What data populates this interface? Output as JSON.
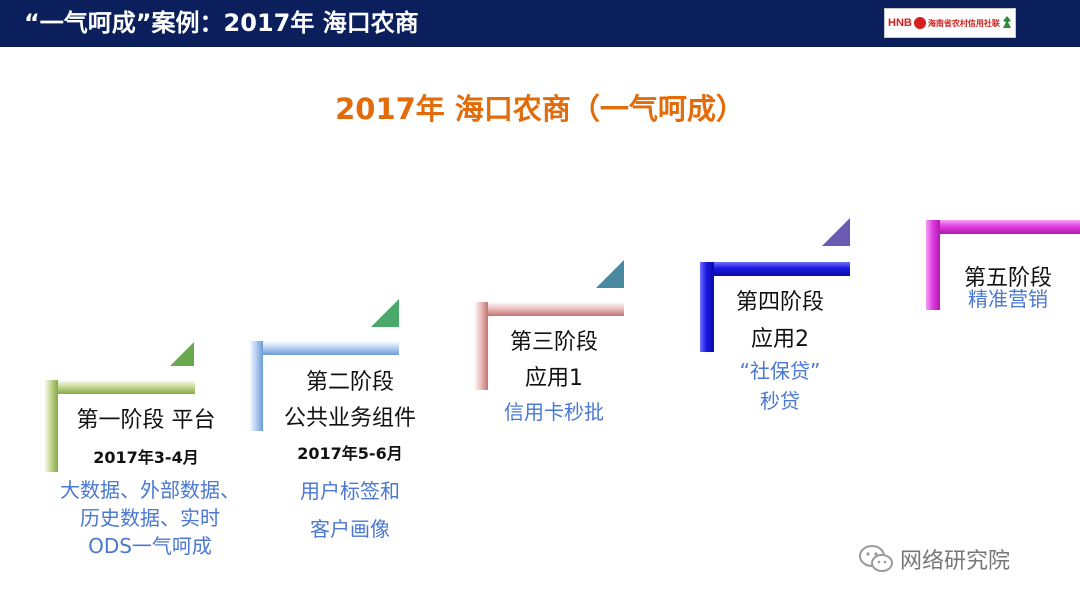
{
  "header": {
    "title": "“一气呵成”案例：2017年 海口农商",
    "logo": {
      "abbr": "HNB",
      "name": "海南省农村信用社联合社"
    }
  },
  "main_title": "2017年 海口农商（一气呵成）",
  "stages": [
    {
      "title": "第一阶段 平台",
      "date": "2017年3-4月",
      "desc": [
        "大数据、外部数据、",
        "历史数据、实时",
        "ODS一气呵成"
      ],
      "color": "#9bbb59"
    },
    {
      "title_lines": [
        "第二阶段",
        "公共业务组件"
      ],
      "date": "2017年5-6月",
      "desc": [
        "用户标签和",
        "客户画像"
      ],
      "color": "#8db3e2"
    },
    {
      "title_lines": [
        "第三阶段",
        "应用1"
      ],
      "desc": [
        "信用卡秒批"
      ],
      "color": "#d99694"
    },
    {
      "title_lines": [
        "第四阶段",
        "应用2"
      ],
      "desc": [
        "“社保贷”",
        "秒贷"
      ],
      "color": "#1f1fd8"
    },
    {
      "title": "第五阶段",
      "desc": [
        "精准营销"
      ],
      "color": "#d62fd6"
    }
  ],
  "watermark": {
    "text": "网络研究院",
    "icon": "wechat-icon"
  }
}
